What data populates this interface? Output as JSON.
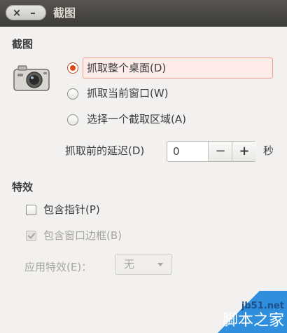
{
  "window": {
    "title": "截图"
  },
  "sections": {
    "capture_title": "截图",
    "effects_title": "特效"
  },
  "capture": {
    "options": [
      {
        "label": "抓取整个桌面(D)",
        "selected": true
      },
      {
        "label": "抓取当前窗口(W)",
        "selected": false
      },
      {
        "label": "选择一个截取区域(A)",
        "selected": false
      }
    ],
    "delay_label": "抓取前的延迟(D)",
    "delay_value": "0",
    "minus": "−",
    "plus": "+",
    "delay_unit": "秒"
  },
  "effects": {
    "include_pointer": {
      "label": "包含指针(P)",
      "checked": false
    },
    "include_border": {
      "label": "包含窗口边框(B)",
      "checked": true,
      "disabled": true
    },
    "apply_effect_label": "应用特效(E)：",
    "apply_effect_value": "无"
  },
  "watermark": {
    "site": "jb51.net",
    "name": "脚本之家"
  },
  "colors": {
    "accent": "#dd4814",
    "titlebar": "#3d3c38",
    "background": "#f2f1f0"
  }
}
